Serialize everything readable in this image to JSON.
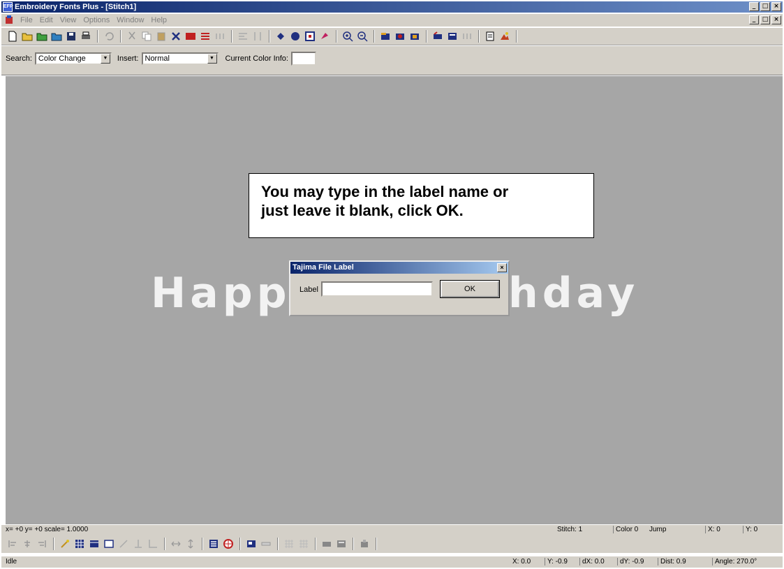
{
  "window": {
    "title": "Embroidery Fonts Plus - [Stitch1]",
    "app_icon_text": "EFP",
    "min_label": "_",
    "max_label": "□",
    "close_label": "×"
  },
  "menubar": {
    "items": [
      "File",
      "Edit",
      "View",
      "Options",
      "Window",
      "Help"
    ]
  },
  "searchbar": {
    "search_label": "Search:",
    "search_value": "Color Change",
    "insert_label": "Insert:",
    "insert_value": "Normal",
    "color_info_label": "Current Color Info:"
  },
  "canvas": {
    "design_text_left": "Happ",
    "design_text_right": "hday",
    "callout_line1": "You may type in the label name or",
    "callout_line2": "just leave it blank, click OK."
  },
  "dialog": {
    "title": "Tajima File Label",
    "label": "Label",
    "input_value": "",
    "ok_label": "OK",
    "close_label": "×"
  },
  "status": {
    "coords": "x= +0 y= +0 scale= 1.0000",
    "stitch": "Stitch: 1",
    "color": "Color 0",
    "jump": "Jump",
    "x": "X: 0",
    "y": "Y: 0",
    "state": "Idle",
    "cur_x": "X: 0.0",
    "cur_y": "Y: -0.9",
    "dx": "dX: 0.0",
    "dy": "dY: -0.9",
    "dist": "Dist: 0.9",
    "angle": "Angle: 270.0°"
  },
  "colors": {
    "title_gradient_start": "#0a246a",
    "chrome": "#d4d0c8",
    "canvas": "#a6a6a6"
  }
}
